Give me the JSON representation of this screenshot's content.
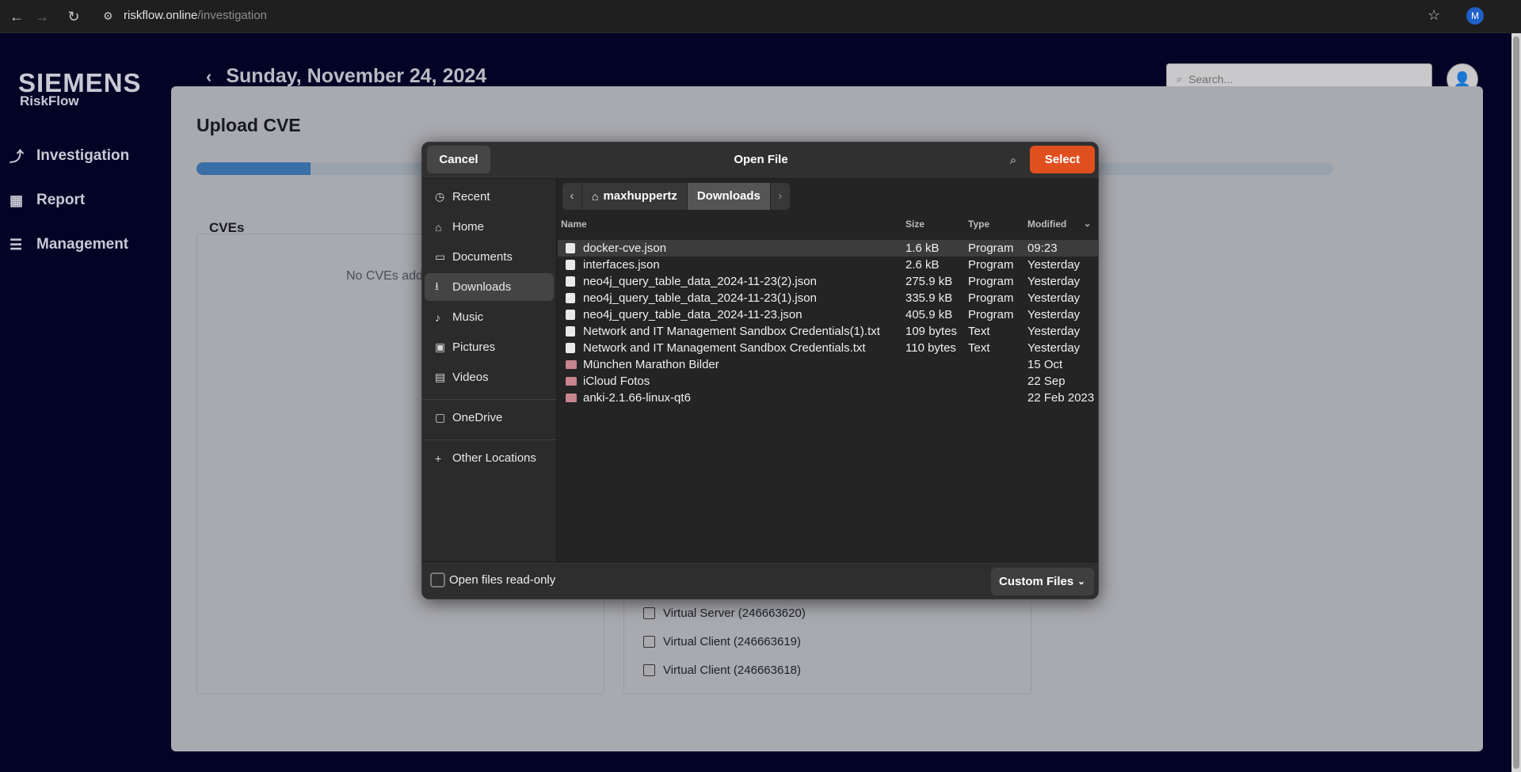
{
  "browser": {
    "url_host": "riskflow.online",
    "url_path": "/investigation",
    "profile_initial": "M"
  },
  "app": {
    "brand": "SIEMENS",
    "product": "RiskFlow",
    "nav": [
      {
        "label": "Investigation",
        "icon": "route-icon"
      },
      {
        "label": "Report",
        "icon": "grid-icon"
      },
      {
        "label": "Management",
        "icon": "list-check-icon"
      }
    ],
    "date_title": "Sunday, November 24, 2024",
    "search_placeholder": "Search...",
    "panel_title": "Upload CVE",
    "progress_fraction": 0.1,
    "cves_title": "CVEs",
    "no_cves_text": "No CVEs add",
    "assets": [
      "Virtual Server (246663620)",
      "Virtual Client (246663619)",
      "Virtual Client (246663618)"
    ]
  },
  "dialog": {
    "title": "Open File",
    "cancel_label": "Cancel",
    "select_label": "Select",
    "places": [
      {
        "label": "Recent",
        "icon": "clock-icon"
      },
      {
        "label": "Home",
        "icon": "home-icon"
      },
      {
        "label": "Documents",
        "icon": "document-icon"
      },
      {
        "label": "Downloads",
        "icon": "download-icon",
        "active": true
      },
      {
        "label": "Music",
        "icon": "music-icon"
      },
      {
        "label": "Pictures",
        "icon": "picture-icon"
      },
      {
        "label": "Videos",
        "icon": "video-icon"
      },
      {
        "label": "OneDrive",
        "icon": "folder-icon"
      },
      {
        "label": "Other Locations",
        "icon": "plus-icon"
      }
    ],
    "path": [
      "maxhuppertz",
      "Downloads"
    ],
    "columns": {
      "name": "Name",
      "size": "Size",
      "type": "Type",
      "modified": "Modified"
    },
    "files": [
      {
        "name": "docker-cve.json",
        "size": "1.6 kB",
        "type": "Program",
        "modified": "09:23",
        "kind": "file",
        "selected": true
      },
      {
        "name": "interfaces.json",
        "size": "2.6 kB",
        "type": "Program",
        "modified": "Yesterday",
        "kind": "file"
      },
      {
        "name": "neo4j_query_table_data_2024-11-23(2).json",
        "size": "275.9 kB",
        "type": "Program",
        "modified": "Yesterday",
        "kind": "file"
      },
      {
        "name": "neo4j_query_table_data_2024-11-23(1).json",
        "size": "335.9 kB",
        "type": "Program",
        "modified": "Yesterday",
        "kind": "file"
      },
      {
        "name": "neo4j_query_table_data_2024-11-23.json",
        "size": "405.9 kB",
        "type": "Program",
        "modified": "Yesterday",
        "kind": "file"
      },
      {
        "name": "Network and IT Management Sandbox Credentials(1).txt",
        "size": "109 bytes",
        "type": "Text",
        "modified": "Yesterday",
        "kind": "text"
      },
      {
        "name": "Network and IT Management Sandbox Credentials.txt",
        "size": "110 bytes",
        "type": "Text",
        "modified": "Yesterday",
        "kind": "text"
      },
      {
        "name": "München Marathon Bilder",
        "size": "",
        "type": "",
        "modified": "15 Oct",
        "kind": "folder"
      },
      {
        "name": "iCloud Fotos",
        "size": "",
        "type": "",
        "modified": "22 Sep",
        "kind": "folder"
      },
      {
        "name": "anki-2.1.66-linux-qt6",
        "size": "",
        "type": "",
        "modified": "22 Feb 2023",
        "kind": "folder"
      }
    ],
    "readonly_label": "Open files read-only",
    "filter_label": "Custom Files"
  }
}
